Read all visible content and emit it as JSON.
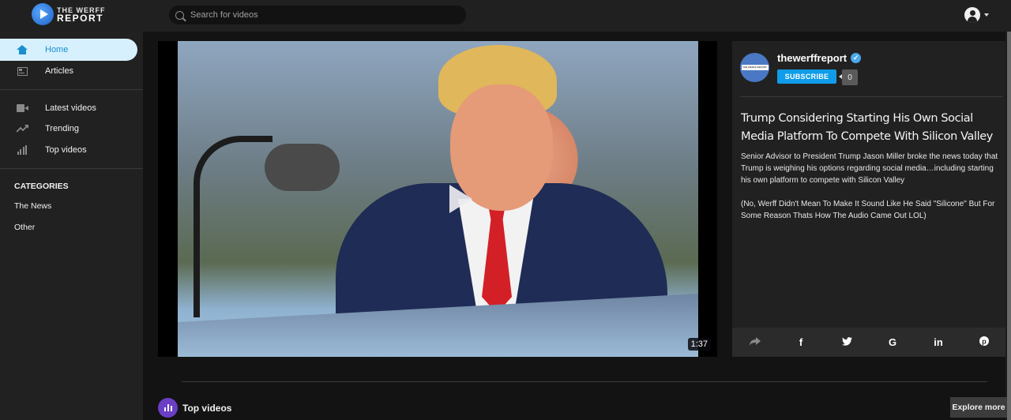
{
  "header": {
    "logo": {
      "line1": "THE WERFF",
      "line2": "REPORT"
    },
    "search": {
      "placeholder": "Search for videos",
      "value": ""
    }
  },
  "sidebar": {
    "items": [
      {
        "label": "Home",
        "icon": "home-icon",
        "active": true
      },
      {
        "label": "Articles",
        "icon": "article-icon",
        "active": false
      },
      {
        "label": "Latest videos",
        "icon": "video-camera-icon",
        "active": false
      },
      {
        "label": "Trending",
        "icon": "trending-icon",
        "active": false
      },
      {
        "label": "Top videos",
        "icon": "bar-chart-icon",
        "active": false
      }
    ],
    "categories": {
      "title": "CATEGORIES",
      "items": [
        "The News",
        "Other"
      ]
    }
  },
  "player": {
    "duration": "1:37"
  },
  "channel": {
    "name": "thewerffreport",
    "verified": true,
    "subscribe_label": "SUBSCRIBE",
    "subscriber_count": "0"
  },
  "video": {
    "title": "Trump Considering Starting His Own Social Media Platform To Compete With Silicon Valley",
    "description": [
      "Senior Advisor to President Trump Jason Miller broke the news today that Trump is weighing his options regarding social media…including starting his own platform to compete with Silicon Valley",
      "(No, Werff Didn't Mean To Make It Sound Like He Said \"Silicone\" But For Some Reason Thats How The Audio Came Out LOL)"
    ]
  },
  "share": {
    "buttons": [
      "share",
      "facebook",
      "twitter",
      "google",
      "linkedin",
      "pinterest"
    ],
    "glyphs": [
      "➦",
      "f",
      "🐦",
      "G",
      "in",
      "ⓟ"
    ]
  },
  "sections": {
    "top_videos_label": "Top videos",
    "explore_more_label": "Explore more"
  },
  "colors": {
    "accent": "#109ce8",
    "active_nav_bg": "#d6f0fd",
    "active_nav_text": "#1a8fd0",
    "top_videos_icon": "#6a3fc4"
  }
}
